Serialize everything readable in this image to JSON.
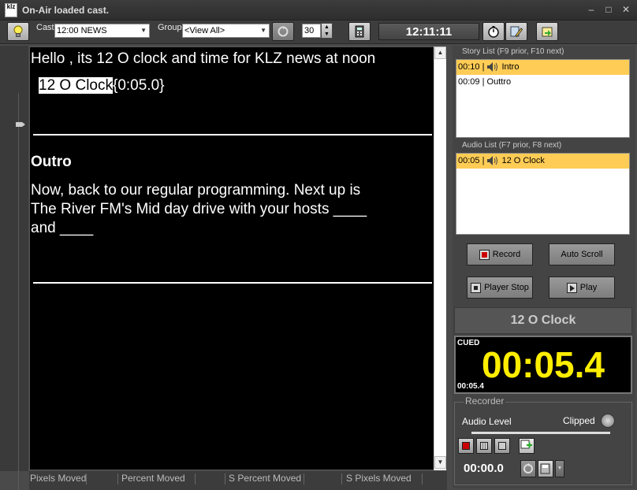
{
  "window": {
    "title": "On-Air loaded cast.",
    "logo_text": "klz"
  },
  "toolbar": {
    "cast_label": "Cast",
    "cast_value": "12:00 NEWS",
    "group_label": "Group",
    "group_value": "<View All>",
    "count_value": "30",
    "clock": "12:11:11"
  },
  "editor": {
    "line1": "Hello , its 12 O clock and time for KLZ news at noon",
    "cue_name": "12 O Clock",
    "cue_time": "{0:05.0}",
    "heading": "Outro",
    "body_line1": "Now, back to our regular programming. Next up is",
    "body_line2": "The River FM's Mid day drive with your hosts ____",
    "body_line3": "and  ____"
  },
  "status": [
    "Pixels Moved",
    "Percent Moved",
    "S Percent Moved",
    "S Pixels Moved"
  ],
  "story_list": {
    "label": "Story List (F9 prior, F10 next)",
    "items": [
      {
        "time": "00:10",
        "name": "Intro",
        "selected": true
      },
      {
        "time": "00:09",
        "name": "Outtro",
        "selected": false
      }
    ]
  },
  "audio_list": {
    "label": "Audio List (F7 prior, F8 next)",
    "items": [
      {
        "time": "00:05",
        "name": "12 O Clock",
        "selected": true
      }
    ]
  },
  "buttons": {
    "record": "Record",
    "auto_scroll": "Auto Scroll",
    "player_stop": "Player Stop",
    "play": "Play"
  },
  "now_playing": "12 O Clock",
  "cued": {
    "label": "CUED",
    "time": "00:05.4",
    "small_time": "00:05.4"
  },
  "recorder": {
    "title": "Recorder",
    "audio_level_label": "Audio Level",
    "clipped_label": "Clipped",
    "time": "00:00.0"
  },
  "colors": {
    "selection": "#ffcc55",
    "cued_time": "#ffee00",
    "editor_bg": "#000000"
  }
}
